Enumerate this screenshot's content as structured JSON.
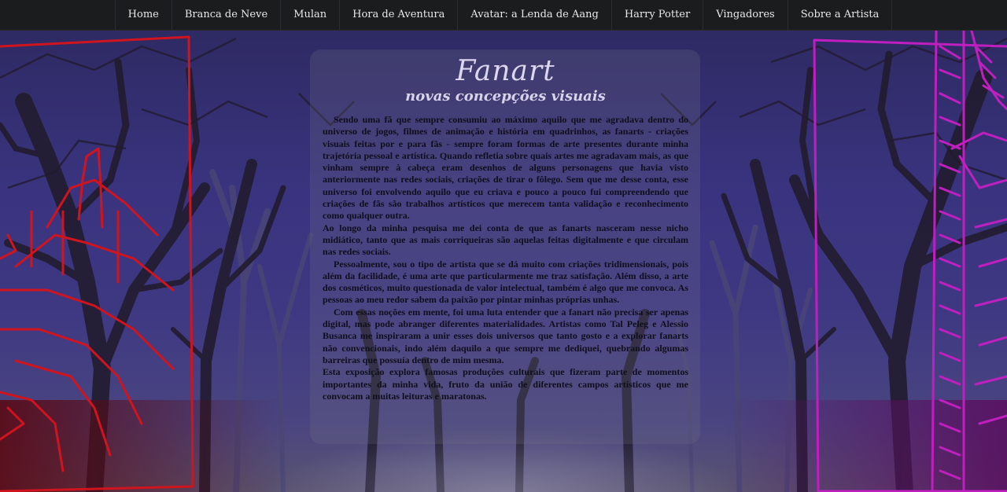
{
  "nav": {
    "items": [
      {
        "label": "Home"
      },
      {
        "label": "Branca de Neve"
      },
      {
        "label": "Mulan"
      },
      {
        "label": "Hora de Aventura"
      },
      {
        "label": "Avatar: a Lenda de Aang"
      },
      {
        "label": "Harry Potter"
      },
      {
        "label": "Vingadores"
      },
      {
        "label": "Sobre a Artista"
      }
    ]
  },
  "panel": {
    "title": "Fanart",
    "subtitle": "novas concepções visuais",
    "paragraphs": [
      "Sendo uma fã que sempre consumiu ao máximo aquilo que me agradava dentro do universo de jogos, filmes de animação e história em quadrinhos, as fanarts - criações visuais feitas por e para fãs - sempre foram formas de arte presentes durante minha trajetória pessoal e artística. Quando refletia sobre quais artes me agradavam mais, as que vinham sempre à cabeça eram desenhos de alguns personagens que havia visto anteriormente nas redes sociais, criações de tirar o fôlego. Sem que me desse conta, esse universo foi envolvendo aquilo que eu criava e pouco a pouco fui compreendendo que criações de fãs são trabalhos artísticos que merecem tanta validação e reconhecimento como qualquer outra.",
      "Ao longo da minha pesquisa me dei conta de que as fanarts nasceram nesse nicho midiático, tanto que as mais corriqueiras são aquelas feitas digitalmente e que circulam nas redes sociais.",
      "Pessoalmente, sou o tipo de artista que se dá muito com criações tridimensionais, pois além da facilidade, é uma arte que particularmente me traz satisfação. Além disso, a arte dos cosméticos, muito questionada de valor intelectual, também é algo que me convoca. As pessoas ao meu redor sabem da paixão por pintar minhas próprias unhas.",
      "Com essas noções em mente, foi uma luta entender que a fanart não precisa ser apenas digital, mas pode abranger diferentes materialidades. Artistas como Tal Peleg e Alessio Busanca me inspiraram a unir esses dois universos que tanto gosto e a explorar fanarts não convencionais, indo além daquilo a que sempre me dediquei, quebrando algumas barreiras que possuía dentro de mim mesma.",
      "Esta exposição explora famosas produções culturais que fizeram parte de momentos importantes da minha vida, fruto da união de diferentes campos artísticos que me convocam a muitas leituras e maratonas."
    ]
  },
  "colors": {
    "nav_bg": "#1b1c1e",
    "sky_top": "#2e2a63",
    "sky_mid": "#3a3480",
    "trees": "#231d33",
    "left_sketch": "#d0141e",
    "right_sketch": "#c01fc0"
  }
}
